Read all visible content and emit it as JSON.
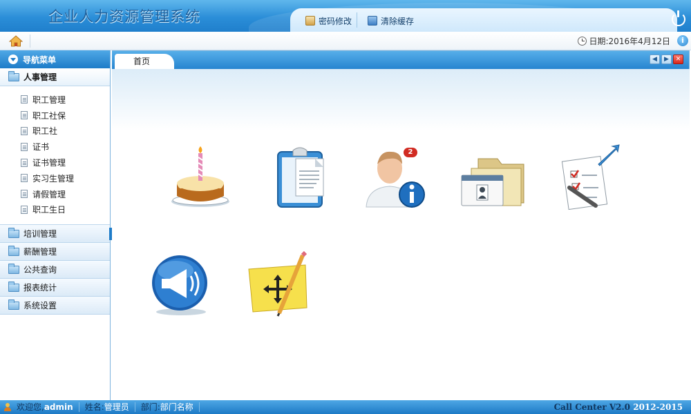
{
  "app": {
    "title": "企业人力资源管理系统"
  },
  "header": {
    "password_label": "密码修改",
    "clear_cache_label": "清除缓存"
  },
  "subbar": {
    "date": "日期:2016年4月12日"
  },
  "sidebar": {
    "title": "导航菜单",
    "active_group": "人事管理",
    "sub_items": [
      "职工管理",
      "职工社保",
      "职工社",
      "证书",
      "证书管理",
      "实习生管理",
      "请假管理",
      "职工生日"
    ],
    "groups": [
      "培训管理",
      "薪酬管理",
      "公共查询",
      "报表统计",
      "系统设置"
    ]
  },
  "tabs": {
    "active": "首页"
  },
  "tiles": {
    "birthday_icon": "birthday-cake-icon",
    "clipboard_icon": "clipboard-document-icon",
    "user_info_icon": "user-info-icon",
    "user_badge_count": "2",
    "folder_icon": "contacts-folder-icon",
    "checklist_icon": "checklist-icon",
    "announce_icon": "megaphone-icon",
    "note_icon": "sticky-note-move-icon"
  },
  "footer": {
    "welcome_label": "欢迎您,",
    "username": "admin",
    "name_label": "姓名:",
    "name_value": "管理员",
    "dept_label": "部门:",
    "dept_value": "部门名称",
    "product": "Call Center V2.0",
    "years": "2012-2015"
  },
  "colors": {
    "header_blue": "#2b8ed8",
    "accent_blue": "#1e7cc8",
    "close_red": "#d6261a"
  }
}
